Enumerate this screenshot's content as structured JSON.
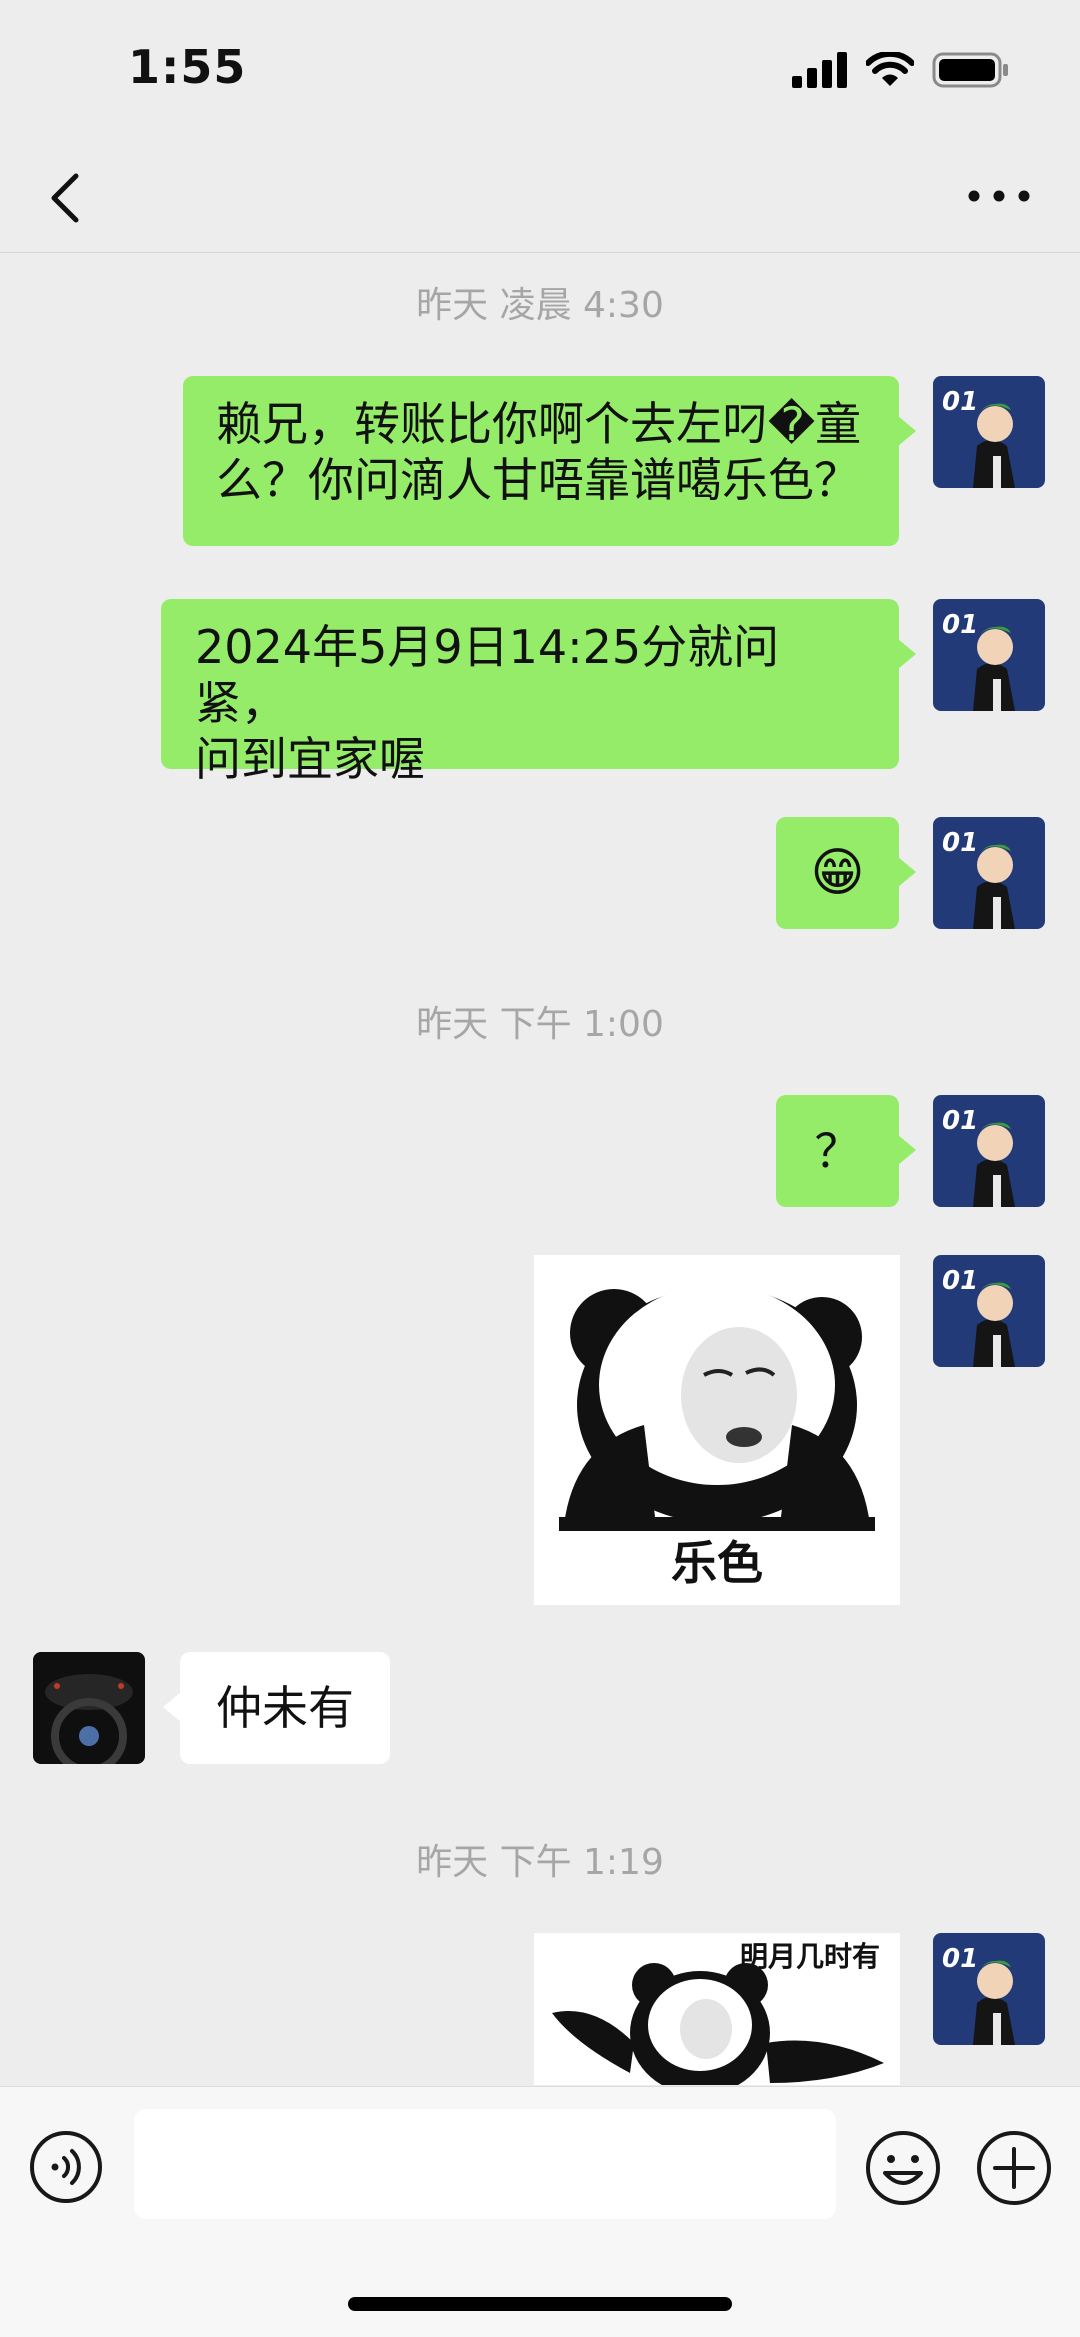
{
  "status_bar": {
    "time": "1:55"
  },
  "nav": {
    "back_icon": "chevron-left-icon",
    "more_icon": "more-dots-icon"
  },
  "chat": {
    "timestamps": [
      "昨天 凌晨 4:30",
      "昨天 下午 1:00",
      "昨天 下午 1:19"
    ],
    "messages": [
      {
        "sender": "me",
        "type": "text",
        "line1": "赖兄，转账比你啊个去左叼�童",
        "line2": "么？你问滴人甘唔靠谱噶乐色？"
      },
      {
        "sender": "me",
        "type": "text",
        "line1": "2024年5月9日14:25分就问紧，",
        "line2": "问到宜家喔"
      },
      {
        "sender": "me",
        "type": "emoji",
        "emoji": "😁"
      },
      {
        "sender": "me",
        "type": "text",
        "text": "？"
      },
      {
        "sender": "me",
        "type": "sticker",
        "caption": "乐色"
      },
      {
        "sender": "them",
        "type": "text",
        "text": "仲未有"
      },
      {
        "sender": "me",
        "type": "sticker",
        "caption": "明月几时有"
      }
    ],
    "my_avatar_text": "01",
    "colors": {
      "my_bubble": "#95ec69",
      "their_bubble": "#ffffff",
      "background": "#ededed"
    }
  },
  "input_bar": {
    "placeholder": "",
    "icons": [
      "voice-icon",
      "emoji-icon",
      "plus-icon"
    ]
  }
}
